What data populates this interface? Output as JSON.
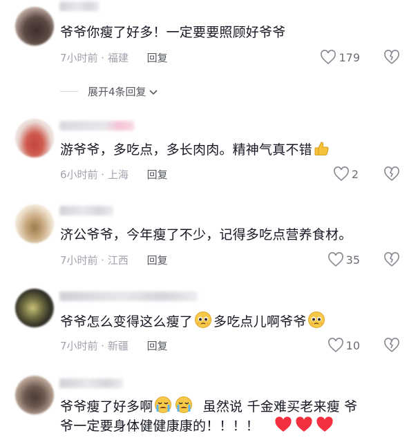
{
  "comments": [
    {
      "text": "爷爷你瘦了好多！一定要要照顾好爷爷",
      "time": "7小时前 · 福建",
      "reply": "回复",
      "likes": "179",
      "expand": "展开4条回复"
    },
    {
      "text": "游爷爷，多吃点，多长肉肉。精神气真不错",
      "emoji": "thumbs-up-emoji",
      "time": "6小时前 · 上海",
      "reply": "回复",
      "likes": "2"
    },
    {
      "text": "济公爷爷，今年瘦了不少，记得多吃点营养食材。",
      "time": "7小时前 · 江西",
      "reply": "回复",
      "likes": "35"
    },
    {
      "text_a": "爷爷怎么变得这么瘦了",
      "text_b": "多吃点儿啊爷爷",
      "emoji": "pleading-face-emoji",
      "time": "7小时前 · 新疆",
      "reply": "回复",
      "likes": "10"
    },
    {
      "text_a": "爷爷瘦了好多啊",
      "text_b": "虽然说 千金难买老来瘦 爷",
      "text_c": "爷一定要身体健健康康的！！！！",
      "emoji": [
        "crying-face-emoji",
        "red-heart-emoji"
      ]
    }
  ],
  "colors": {
    "text": "#161823",
    "meta": "#a0a2ad",
    "heart": "#fe2c55"
  }
}
